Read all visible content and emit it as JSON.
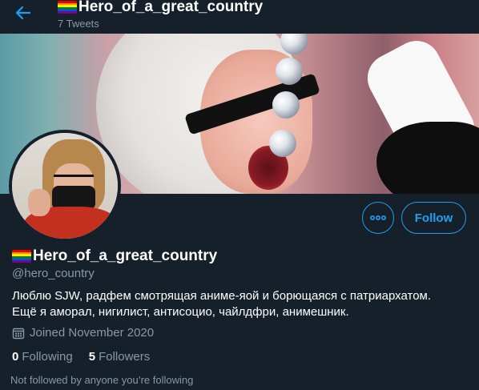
{
  "header": {
    "title": "Hero_of_a_great_country",
    "tweet_count": "7 Tweets"
  },
  "profile": {
    "display_name": "Hero_of_a_great_country",
    "handle": "@hero_country",
    "bio_lines": [
      "Люблю SJW, радфем смотрящая аниме-яой и борющаяся с патриархатом.",
      "Ещё я аморал, нигилист, антисоцио, чайлдфри, анимешник."
    ],
    "joined": "Joined November 2020",
    "following_count": "0",
    "following_label": "Following",
    "followers_count": "5",
    "followers_label": "Followers",
    "not_followed": "Not followed by anyone you’re following"
  },
  "actions": {
    "follow_label": "Follow"
  },
  "colors": {
    "background": "#15202b",
    "accent": "#1da1f2",
    "secondary_text": "#8899a6",
    "flag_stripes": [
      "#e40303",
      "#ff8c00",
      "#ffed00",
      "#008026",
      "#004dff",
      "#750787"
    ]
  },
  "icons": {
    "back": "arrow-left-icon",
    "more": "more-dots-icon",
    "calendar": "calendar-icon",
    "flag": "rainbow-flag-icon"
  }
}
